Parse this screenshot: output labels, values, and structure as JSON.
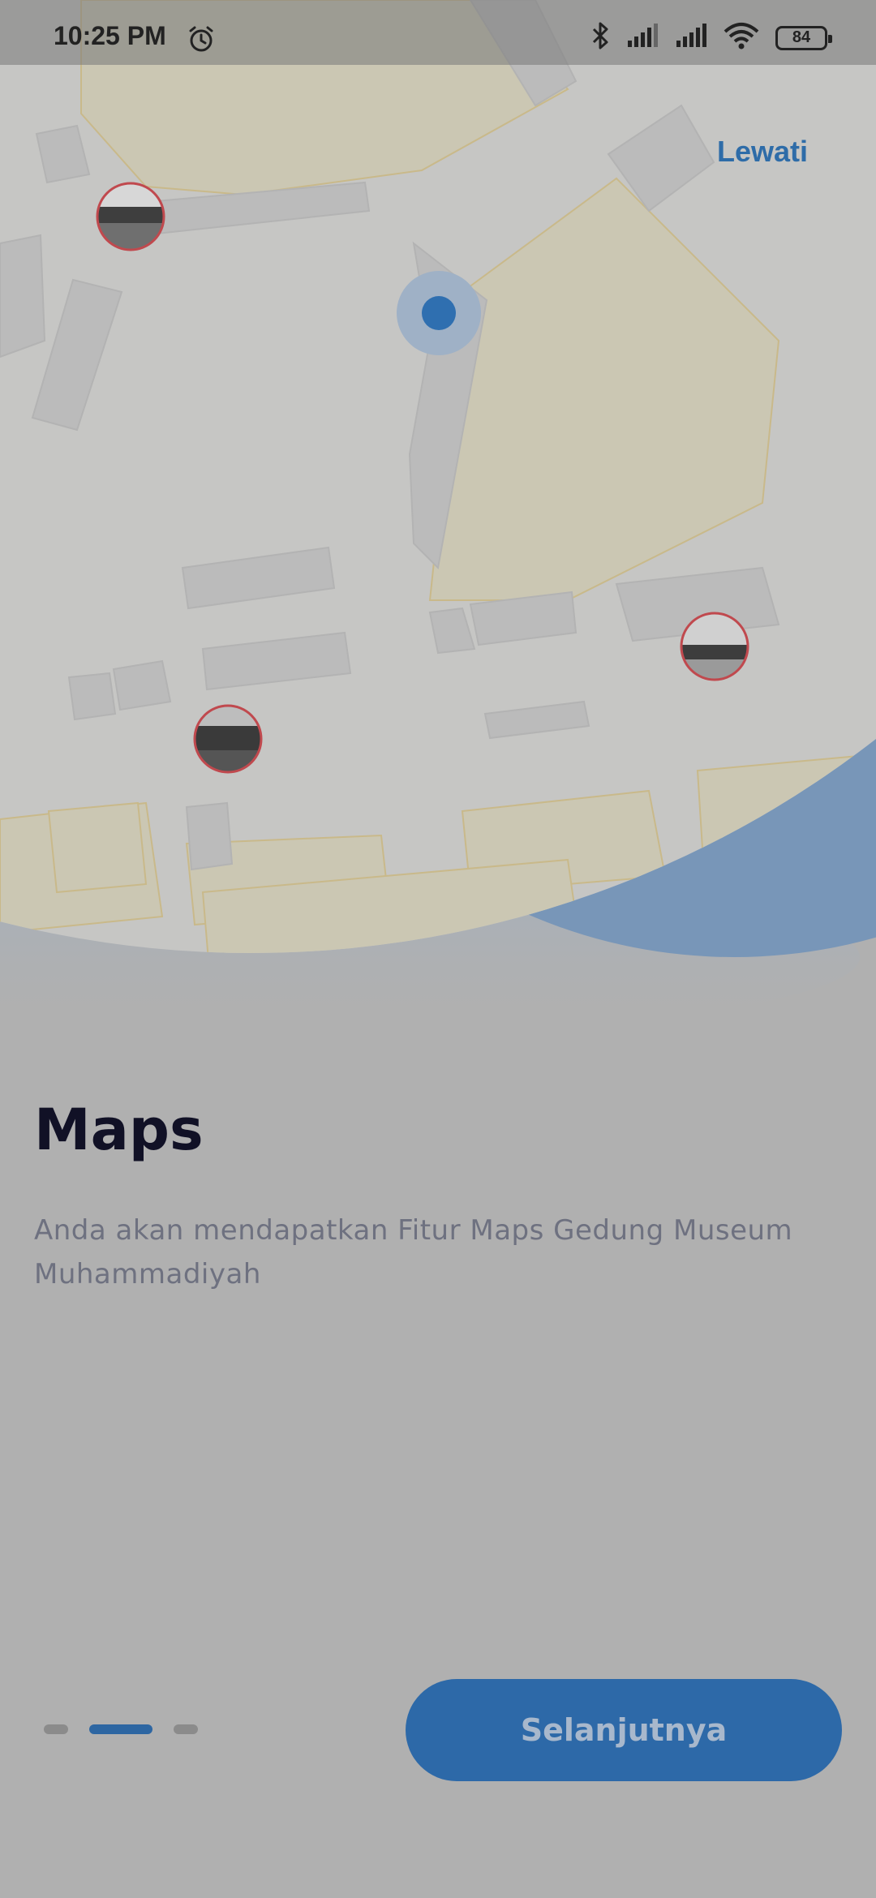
{
  "status_bar": {
    "time": "10:25 PM",
    "battery": "84",
    "icons": [
      "alarm-icon",
      "bluetooth-icon",
      "signal-icon",
      "signal-icon",
      "wifi-icon",
      "battery-icon"
    ]
  },
  "header": {
    "skip_label": "Lewati"
  },
  "content": {
    "title": "Maps",
    "description": "Anda akan mendapatkan Fitur Maps  Gedung Museum Muhammadiyah"
  },
  "pagination": {
    "total": 3,
    "active_index": 1
  },
  "footer": {
    "next_label": "Selanjutnya"
  },
  "colors": {
    "overlay_bg": "#b0b0b0",
    "accent": "#2d69a8",
    "title": "#111126",
    "description": "#6e7180"
  }
}
